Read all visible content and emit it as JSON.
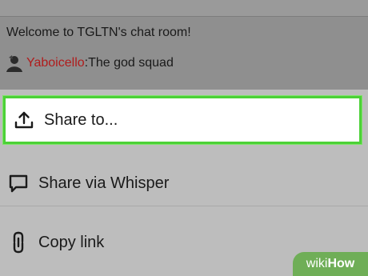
{
  "chat": {
    "welcome_text": "Welcome to TGLTN's chat room!",
    "message": {
      "username": "Yaboicello",
      "separator": ": ",
      "text": "The god squad"
    }
  },
  "share_sheet": {
    "items": [
      {
        "label": "Share to...",
        "icon": "upload-icon"
      },
      {
        "label": "Share via Whisper",
        "icon": "speech-bubble-icon"
      },
      {
        "label": "Copy link",
        "icon": "link-icon"
      }
    ]
  },
  "watermark": {
    "part1": "wiki",
    "part2": "How"
  },
  "colors": {
    "highlight": "#4cd137",
    "username": "#b01c1c",
    "watermark": "#6fae57"
  }
}
